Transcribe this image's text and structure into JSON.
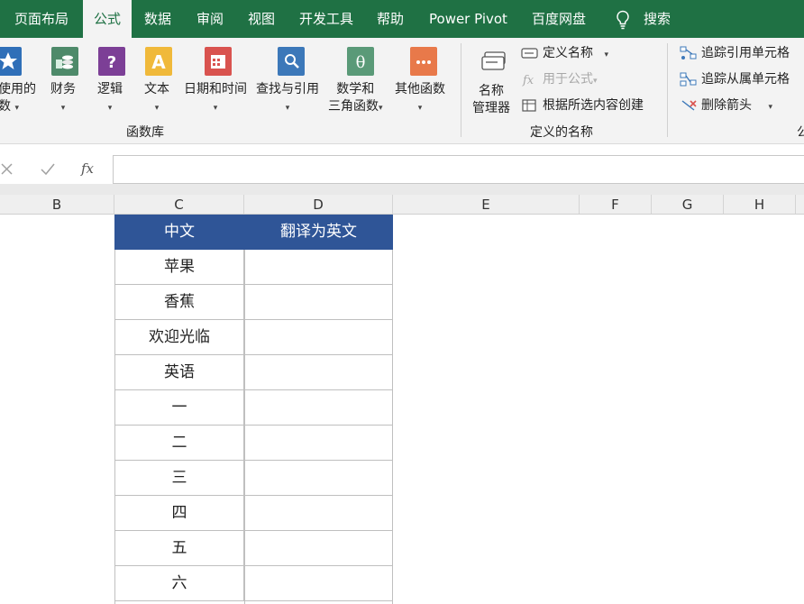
{
  "tabs": [
    {
      "label": "页面布局",
      "active": false
    },
    {
      "label": "公式",
      "active": true
    },
    {
      "label": "数据",
      "active": false
    },
    {
      "label": "审阅",
      "active": false
    },
    {
      "label": "视图",
      "active": false
    },
    {
      "label": "开发工具",
      "active": false
    },
    {
      "label": "帮助",
      "active": false
    },
    {
      "label": "Power Pivot",
      "active": false
    },
    {
      "label": "百度网盘",
      "active": false
    }
  ],
  "search_label": "搜索",
  "ribbon": {
    "function_library": {
      "group_label": "函数库",
      "buttons": [
        {
          "line1": "使用的",
          "line2": "数",
          "icon": "star-icon"
        },
        {
          "line1": "财务",
          "line2": "",
          "icon": "coins-icon"
        },
        {
          "line1": "逻辑",
          "line2": "",
          "icon": "question-icon"
        },
        {
          "line1": "文本",
          "line2": "",
          "icon": "text-a-icon"
        },
        {
          "line1": "日期和时间",
          "line2": "",
          "icon": "calendar-icon"
        },
        {
          "line1": "查找与引用",
          "line2": "",
          "icon": "magnifier-icon"
        },
        {
          "line1": "数学和",
          "line2": "三角函数",
          "icon": "theta-icon"
        },
        {
          "line1": "其他函数",
          "line2": "",
          "icon": "more-icon"
        }
      ]
    },
    "defined_names": {
      "group_label": "定义的名称",
      "name_manager_line1": "名称",
      "name_manager_line2": "管理器",
      "define_name": "定义名称",
      "use_in_formula": "用于公式",
      "create_from_selection": "根据所选内容创建"
    },
    "formula_auditing": {
      "trace_precedents": "追踪引用单元格",
      "trace_dependents": "追踪从属单元格",
      "remove_arrows": "删除箭头",
      "group_label_partial": "公"
    }
  },
  "formula_bar": {
    "value": ""
  },
  "columns": [
    "B",
    "C",
    "D",
    "E",
    "F",
    "G",
    "H"
  ],
  "table": {
    "headers": [
      "中文",
      "翻译为英文"
    ],
    "rows": [
      [
        "苹果",
        ""
      ],
      [
        "香蕉",
        ""
      ],
      [
        "欢迎光临",
        ""
      ],
      [
        "英语",
        ""
      ],
      [
        "一",
        ""
      ],
      [
        "二",
        ""
      ],
      [
        "三",
        ""
      ],
      [
        "四",
        ""
      ],
      [
        "五",
        ""
      ],
      [
        "六",
        ""
      ]
    ]
  },
  "colors": {
    "tab_bar": "#1f7144",
    "table_header": "#2f5597"
  }
}
